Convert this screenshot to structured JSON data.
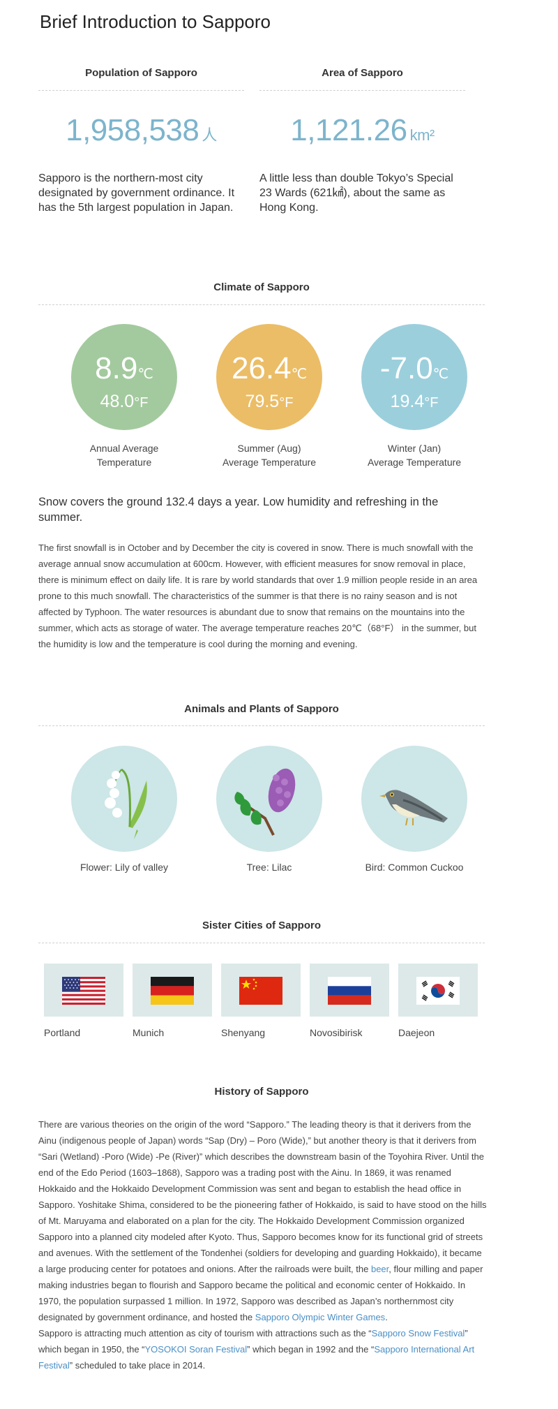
{
  "page": {
    "title": "Brief Introduction to Sapporo"
  },
  "population": {
    "heading": "Population of Sapporo",
    "value": "1,958,538",
    "unit": "人",
    "description": "Sapporo is the northern-most city designated by government ordinance. It has the 5th largest population in Japan."
  },
  "area": {
    "heading": "Area of Sapporo",
    "value": "1,121.26",
    "unit": "km²",
    "description": "A little less than double Tokyo’s Special 23 Wards (621㎢), about the same as Hong Kong."
  },
  "climate": {
    "heading": "Climate of Sapporo",
    "items": [
      {
        "celsius": "8.9",
        "c_unit": "℃",
        "fahrenheit": "48.0",
        "f_unit": "°F",
        "line1": "Annual Average",
        "line2": "Temperature",
        "color": "#a3ca9e"
      },
      {
        "celsius": "26.4",
        "c_unit": "℃",
        "fahrenheit": "79.5",
        "f_unit": "°F",
        "line1": "Summer (Aug)",
        "line2": "Average Temperature",
        "color": "#ebbd67"
      },
      {
        "celsius": "-7.0",
        "c_unit": "℃",
        "fahrenheit": "19.4",
        "f_unit": "°F",
        "line1": "Winter (Jan)",
        "line2": "Average Temperature",
        "color": "#9ccfdc"
      }
    ],
    "lead": "Snow covers the ground 132.4 days a year. Low humidity and refreshing in the summer.",
    "body": "The first snowfall is in October and by December the city is covered in snow. There is much snowfall with the average annual snow accumulation at 600cm. However, with efficient measures for snow removal in place, there is minimum effect on daily life. It is rare by world standards that over 1.9 million people reside in an area prone to this much snowfall. The characteristics of the summer is that there is no rainy season and is not affected by Typhoon. The water resources is abundant due to snow that remains on the mountains into the summer, which acts as storage of water. The average temperature reaches 20℃（68°F） in the summer, but the humidity is low and the temperature is cool during the morning and evening."
  },
  "nature": {
    "heading": "Animals and Plants of Sapporo",
    "items": [
      {
        "label": "Flower: Lily of valley",
        "icon": "lily-of-valley-icon"
      },
      {
        "label": "Tree: Lilac",
        "icon": "lilac-icon"
      },
      {
        "label": "Bird: Common Cuckoo",
        "icon": "cuckoo-icon"
      }
    ]
  },
  "sister_cities": {
    "heading": "Sister Cities of Sapporo",
    "items": [
      {
        "name": "Portland",
        "flag": "usa-flag-icon"
      },
      {
        "name": "Munich",
        "flag": "germany-flag-icon"
      },
      {
        "name": "Shenyang",
        "flag": "china-flag-icon"
      },
      {
        "name": "Novosibirisk",
        "flag": "russia-flag-icon"
      },
      {
        "name": "Daejeon",
        "flag": "korea-flag-icon"
      }
    ]
  },
  "history": {
    "heading": "History of Sapporo",
    "p1_a": "There are various theories on the origin of the word “Sapporo.” The leading theory is that it derivers from the Ainu (indigenous people of Japan) words “Sap (Dry) – Poro (Wide),” but another theory is that it derivers from “Sari (Wetland) -Poro (Wide) -Pe (River)” which describes the downstream basin of the Toyohira River. Until the end of the Edo Period (1603–1868), Sapporo was a trading post with the Ainu. In 1869, it was renamed Hokkaido and the Hokkaido Development Commission was sent and began to establish the head office in Sapporo. Yoshitake Shima, considered to be the pioneering father of Hokkaido, is said to have stood on the hills of Mt. Maruyama and elaborated on a plan for the city. The Hokkaido Development Commission organized Sapporo into a planned city modeled after Kyoto. Thus, Sapporo becomes know for its functional grid of streets and avenues. With the settlement of the Tondenhei (soldiers for developing and guarding Hokkaido), it became a large producing center for potatoes and onions. After the railroads were built, the ",
    "link_beer": "beer",
    "p1_b": ", flour milling and paper making industries began to flourish and Sapporo became the political and economic center of Hokkaido. In 1970, the population surpassed 1 million. In 1972, Sapporo was described as Japan’s northernmost city designated by government ordinance, and hosted the ",
    "link_olympics": "Sapporo Olympic Winter Games",
    "p1_c": ".",
    "p2_a": "Sapporo is attracting much attention as city of tourism with attractions such as the “",
    "link_snow": "Sapporo Snow Festival",
    "p2_b": "” which began in 1950, the “",
    "link_yosakoi": "YOSOKOI Soran Festival",
    "p2_c": "” which began in 1992 and the “",
    "link_art": "Sapporo International Art Festival",
    "p2_d": "” scheduled to take place in 2014."
  }
}
